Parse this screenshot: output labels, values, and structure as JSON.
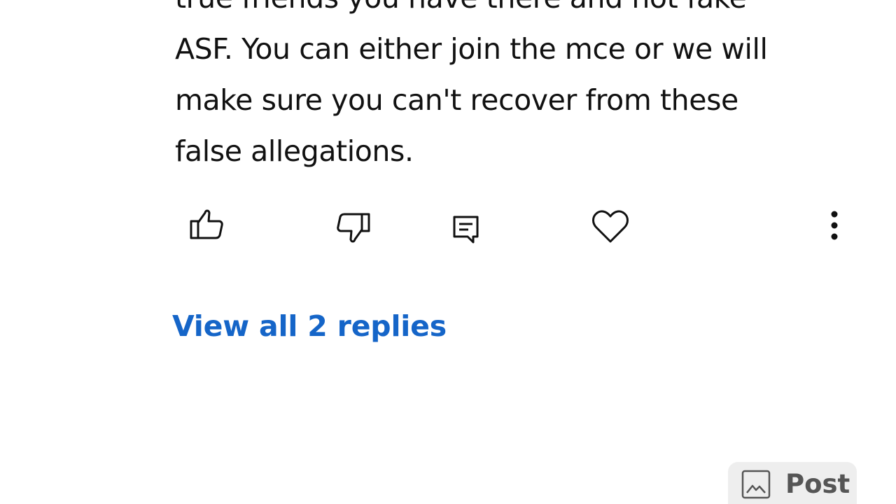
{
  "comment": {
    "lines": [
      "true friends you have there and not fake",
      "ASF. You can either join the mce or we will",
      "make sure you can't recover from these",
      "false allegations."
    ]
  },
  "actions": {
    "like_icon": "thumbs-up-icon",
    "dislike_icon": "thumbs-down-icon",
    "reply_icon": "comment-icon",
    "favorite_icon": "heart-icon",
    "more_icon": "more-vertical-icon"
  },
  "replies": {
    "view_all_label": "View all 2 replies"
  },
  "composer": {
    "image_icon": "image-icon",
    "post_label": "Post"
  },
  "colors": {
    "link": "#1565c8",
    "text": "#111111",
    "post_button_bg": "#eeeeee",
    "post_button_text": "#555555"
  }
}
